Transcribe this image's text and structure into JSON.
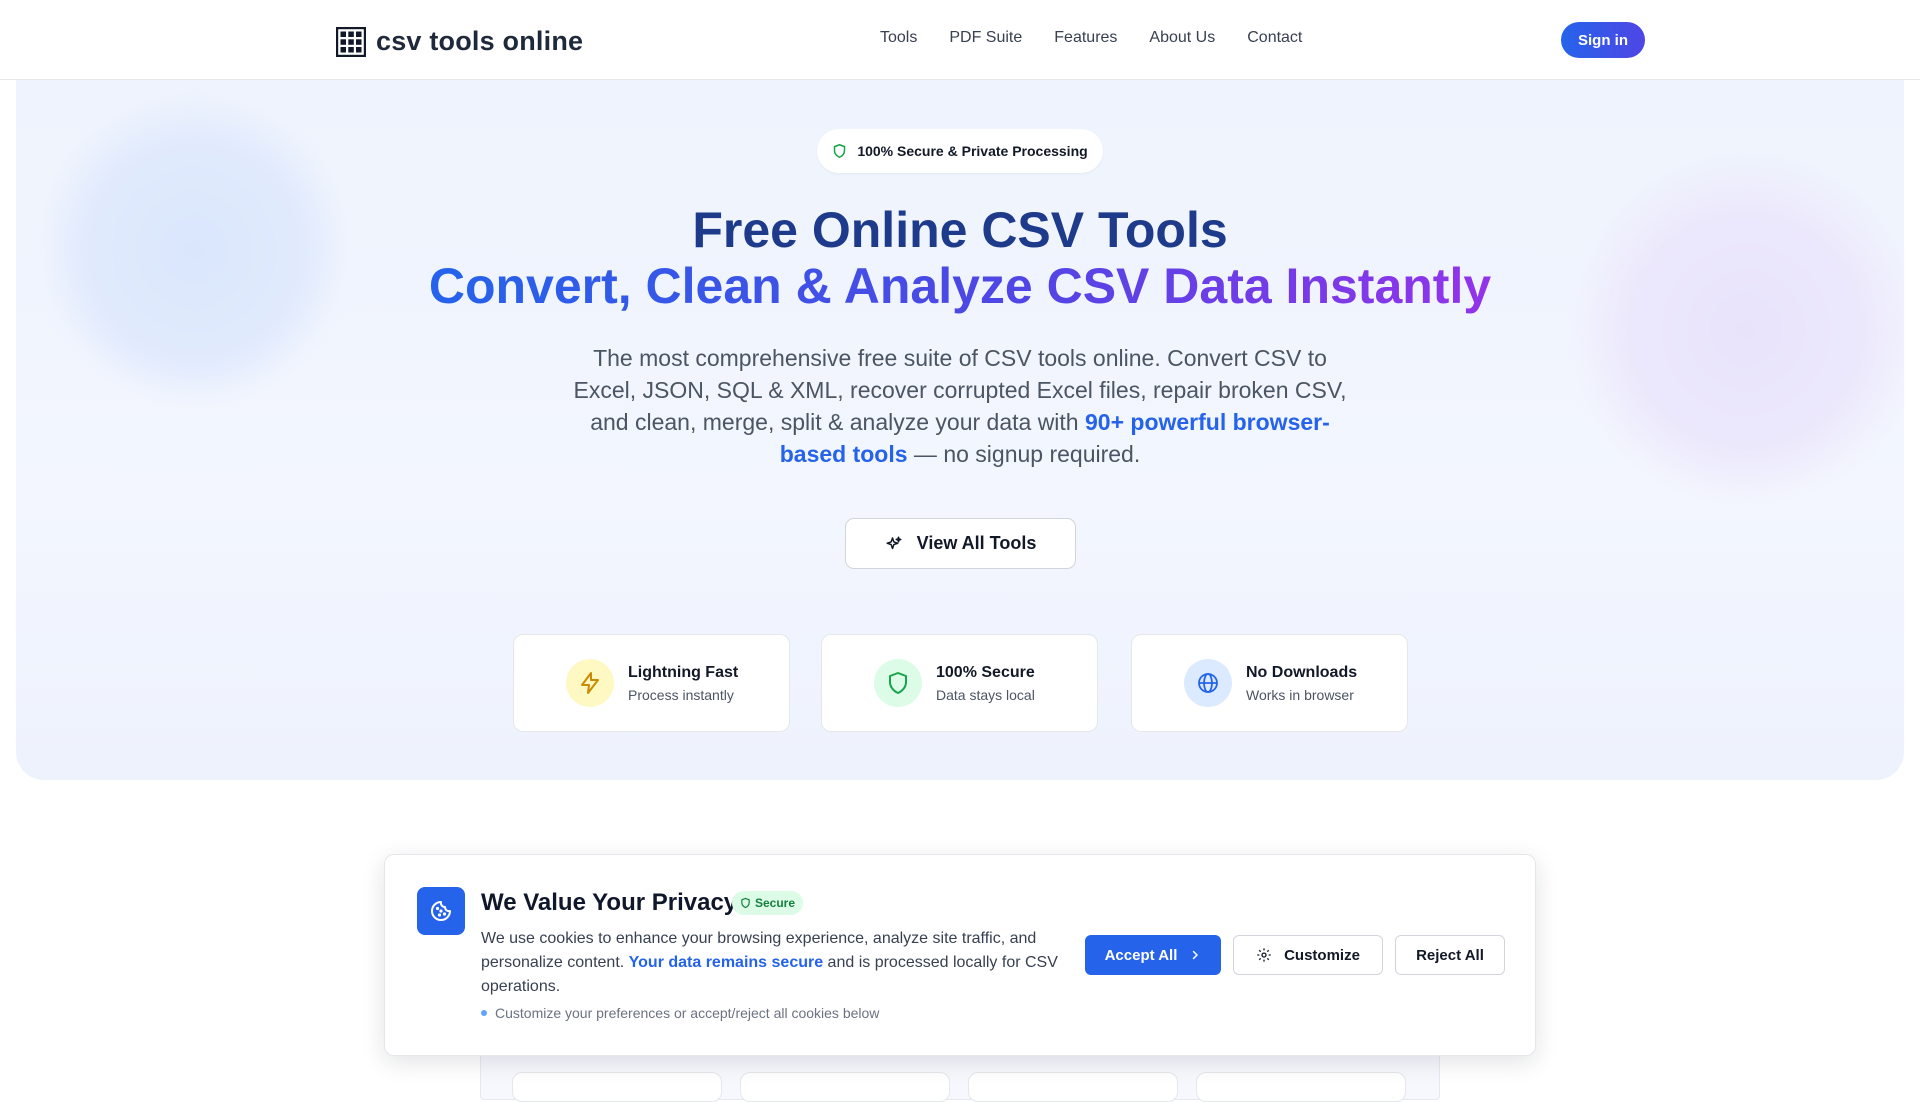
{
  "header": {
    "logo_text": "csv tools online",
    "nav": [
      {
        "label": "Tools"
      },
      {
        "label": "PDF Suite"
      },
      {
        "label": "Features"
      },
      {
        "label": "About Us"
      },
      {
        "label": "Contact"
      }
    ],
    "signin_label": "Sign in"
  },
  "hero": {
    "badge": "100% Secure & Private Processing",
    "title_line1": "Free Online CSV Tools",
    "title_line2": "Convert, Clean & Analyze CSV Data Instantly",
    "subtitle_before": "The most comprehensive free suite of CSV tools online. Convert CSV to Excel, JSON, SQL & XML, recover corrupted Excel files, repair broken CSV, and clean, merge, split & analyze your data with ",
    "subtitle_highlight": "90+ powerful browser-based tools",
    "subtitle_after": " — no signup required.",
    "cta_label": "View All Tools",
    "features": [
      {
        "title": "Lightning Fast",
        "subtitle": "Process instantly",
        "icon": "lightning-icon",
        "color": "#ca8a04",
        "bg": "#fef9c3"
      },
      {
        "title": "100% Secure",
        "subtitle": "Data stays local",
        "icon": "shield-icon",
        "color": "#16a34a",
        "bg": "#dcfce7"
      },
      {
        "title": "No Downloads",
        "subtitle": "Works in browser",
        "icon": "globe-icon",
        "color": "#2563eb",
        "bg": "#dbeafe"
      }
    ]
  },
  "cookie": {
    "title": "We Value Your Privacy",
    "secure_badge": "Secure",
    "text_before": "We use cookies to enhance your browsing experience, analyze site traffic, and personalize content. ",
    "text_highlight": "Your data remains secure",
    "text_after": " and is processed locally for CSV operations.",
    "note": "Customize your preferences or accept/reject all cookies below",
    "accept_label": "Accept All",
    "customize_label": "Customize",
    "reject_label": "Reject All"
  },
  "colors": {
    "brand_blue": "#2563eb",
    "brand_indigo": "#4f46e5",
    "brand_purple": "#9333ea",
    "title_navy": "#1e3a8a"
  }
}
